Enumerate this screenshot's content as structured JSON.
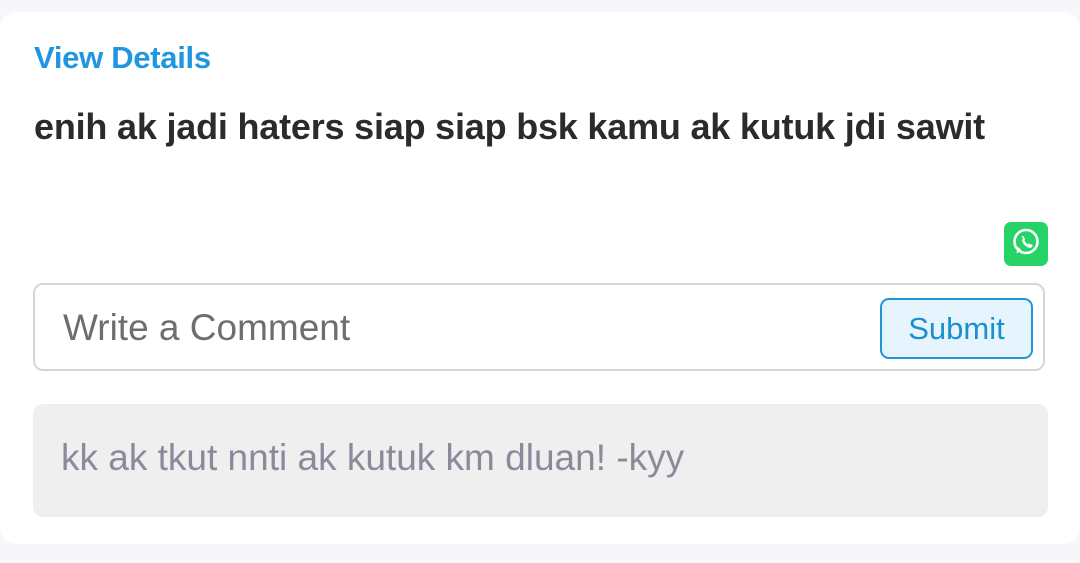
{
  "card": {
    "view_details_label": "View Details",
    "message": "enih ak jadi haters siap siap bsk kamu ak kutuk jdi sawit",
    "share_icon": "whatsapp-icon"
  },
  "comment": {
    "placeholder": "Write a Comment",
    "value": "",
    "submit_label": "Submit"
  },
  "reply": {
    "text": "kk ak tkut nnti ak kutuk km dluan! -kyy"
  },
  "colors": {
    "link": "#2196e0",
    "whatsapp": "#25d366",
    "submit_border": "#2196d6",
    "submit_bg": "#e6f5fd",
    "reply_bg": "#efefef"
  }
}
